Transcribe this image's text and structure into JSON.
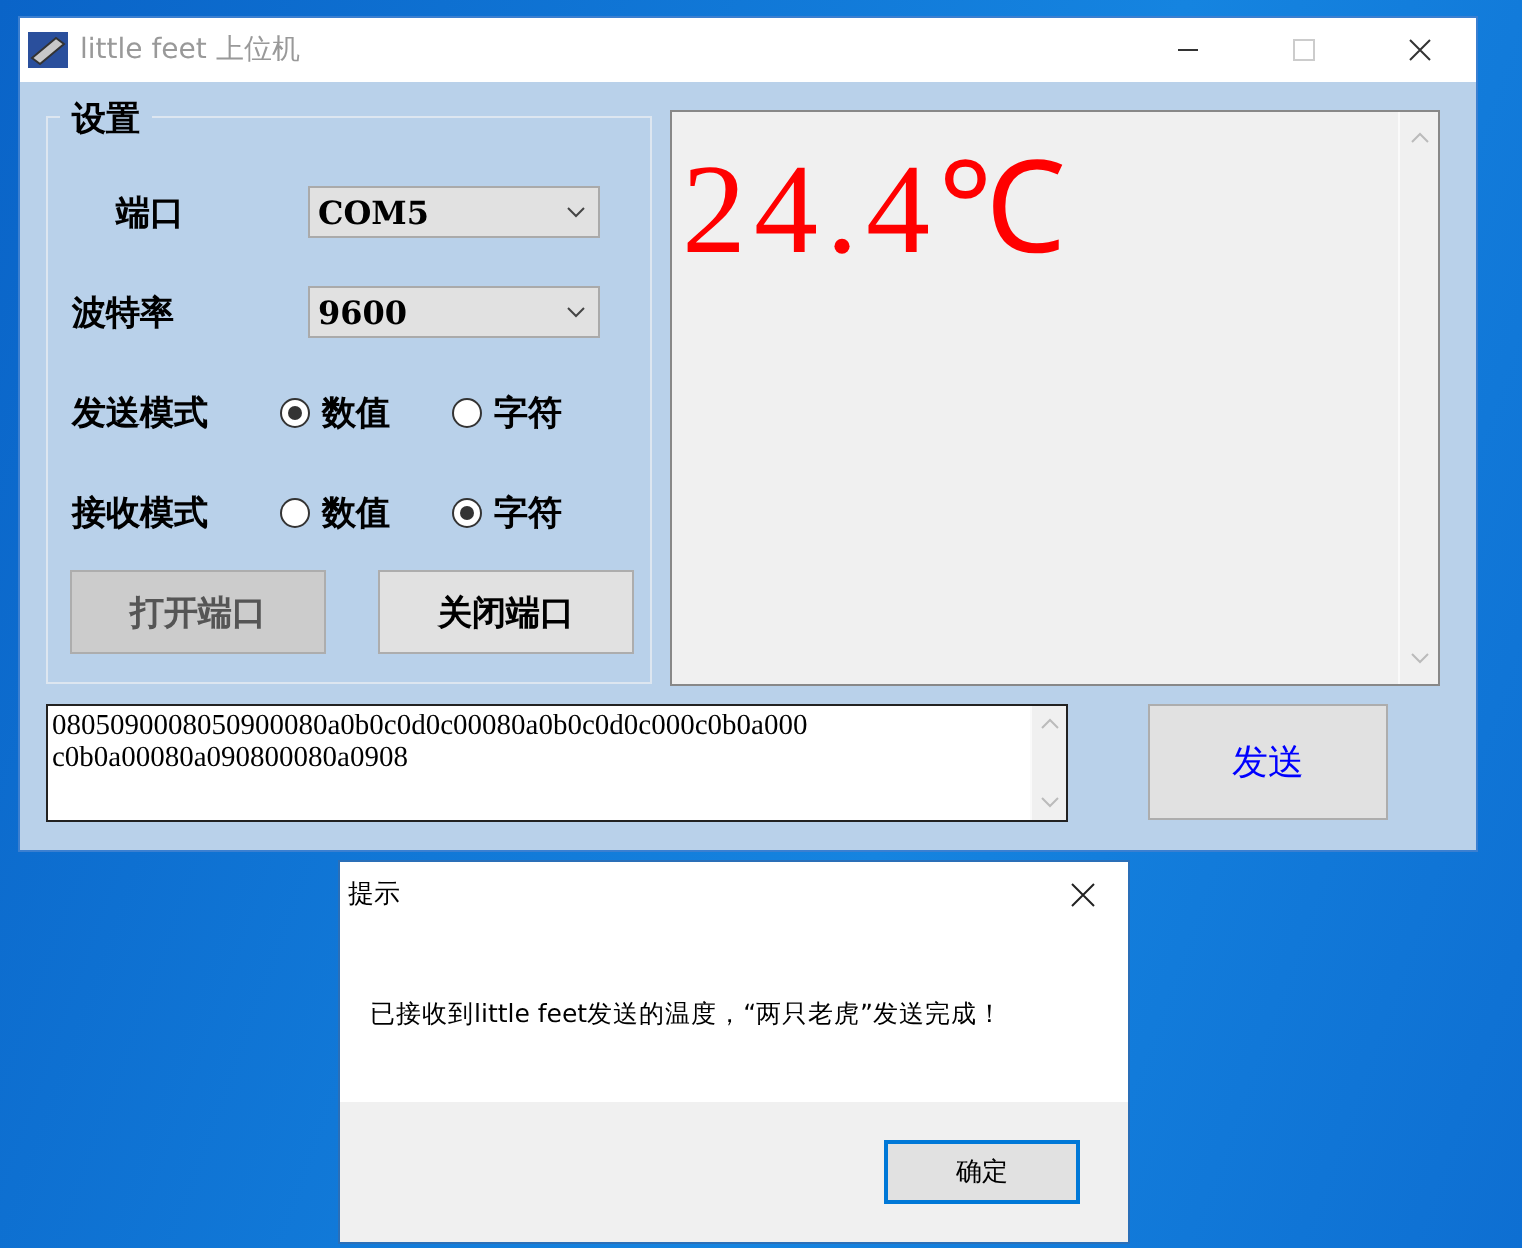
{
  "window": {
    "title": "little feet 上位机"
  },
  "settings": {
    "title": "设置",
    "port": {
      "label": "端口",
      "value": "COM5"
    },
    "baud": {
      "label": "波特率",
      "value": "9600"
    },
    "modes": [
      {
        "label": "发送模式",
        "options": [
          {
            "label": "数值",
            "selected": true
          },
          {
            "label": "字符",
            "selected": false
          }
        ]
      },
      {
        "label": "接收模式",
        "options": [
          {
            "label": "数值",
            "selected": false
          },
          {
            "label": "字符",
            "selected": true
          }
        ]
      }
    ],
    "buttons": [
      {
        "label": "打开端口",
        "disabled": true
      },
      {
        "label": "关闭端口",
        "disabled": false
      }
    ]
  },
  "display": {
    "text": "24.4℃"
  },
  "send_box": {
    "lines": [
      "0805090008050900080a0b0c0d0c00080a0b0c0d0c000c0b0a000",
      "c0b0a00080a090800080a0908"
    ]
  },
  "send_button": {
    "label": "发送"
  },
  "dialog": {
    "title": "提示",
    "message": "已接收到little feet发送的温度，“两只老虎”发送完成！",
    "ok": "确定"
  }
}
